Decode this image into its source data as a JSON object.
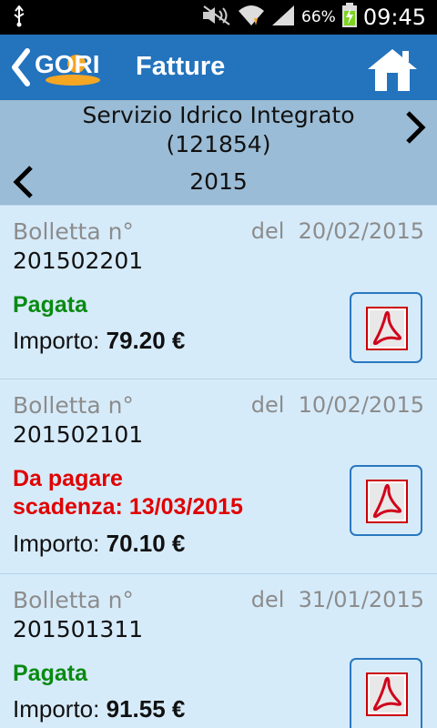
{
  "status_bar": {
    "battery": "66%",
    "time": "09:45"
  },
  "header": {
    "title": "Fatture",
    "logo_text": "GORI"
  },
  "service": {
    "name": "Servizio Idrico Integrato",
    "code": "(121854)",
    "year": "2015"
  },
  "invoices": [
    {
      "label": "Bolletta n°",
      "date": "del  20/02/2015",
      "number": "201502201",
      "status": "Pagata",
      "status_line2": "",
      "amount_label": "Importo:",
      "amount": "79.20 €"
    },
    {
      "label": "Bolletta n°",
      "date": "del  10/02/2015",
      "number": "201502101",
      "status": "Da pagare",
      "status_line2": "scadenza: 13/03/2015",
      "amount_label": "Importo:",
      "amount": "70.10 €"
    },
    {
      "label": "Bolletta n°",
      "date": "del  31/01/2015",
      "number": "201501311",
      "status": "Pagata",
      "status_line2": "",
      "amount_label": "Importo:",
      "amount": "91.55 €"
    }
  ],
  "colors": {
    "header": "#2373bd",
    "service_bar": "#9bbcd6",
    "list_bg": "#d6ebfa",
    "paid": "#0a8a12",
    "due": "#e00000",
    "logo_sun": "#f5a623"
  }
}
